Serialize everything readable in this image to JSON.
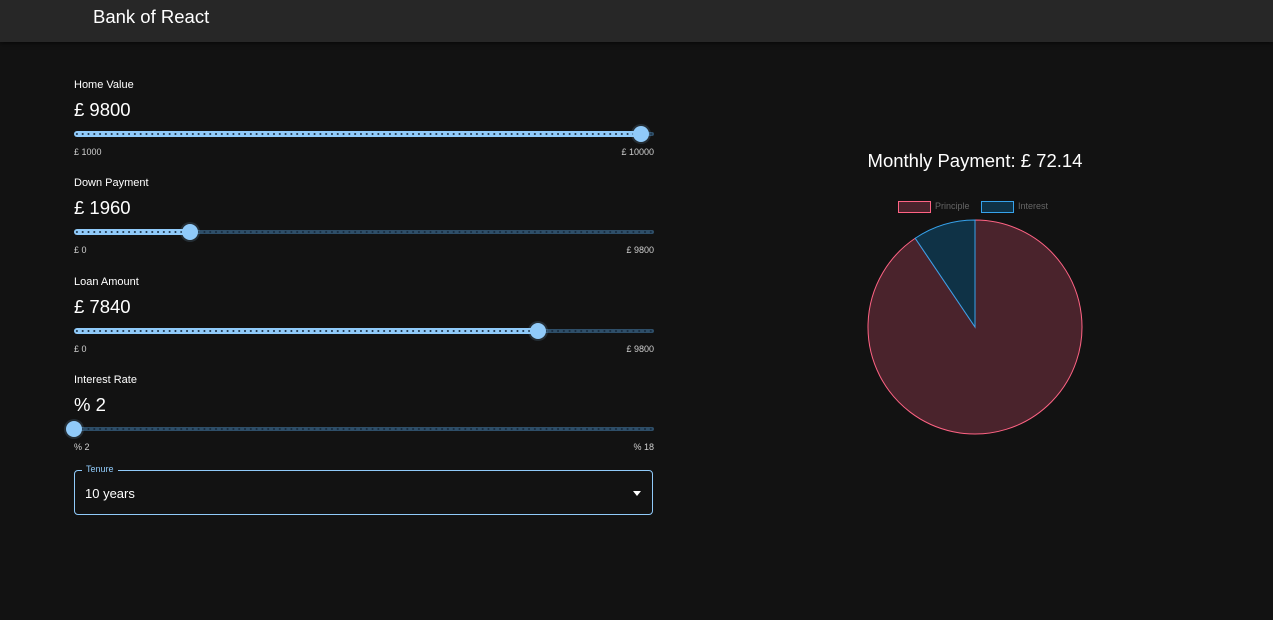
{
  "app": {
    "title": "Bank of React"
  },
  "sliders": [
    {
      "label": "Home Value",
      "value_text": "£ 9800",
      "value": 9800,
      "min": 1000,
      "max": 10000,
      "min_text": "£ 1000",
      "max_text": "£ 10000"
    },
    {
      "label": "Down Payment",
      "value_text": "£ 1960",
      "value": 1960,
      "min": 0,
      "max": 9800,
      "min_text": "£ 0",
      "max_text": "£ 9800"
    },
    {
      "label": "Loan Amount",
      "value_text": "£ 7840",
      "value": 7840,
      "min": 0,
      "max": 9800,
      "min_text": "£ 0",
      "max_text": "£ 9800"
    },
    {
      "label": "Interest Rate",
      "value_text": "% 2",
      "value": 2,
      "min": 2,
      "max": 18,
      "min_text": "% 2",
      "max_text": "% 18"
    }
  ],
  "tenure": {
    "label": "Tenure",
    "value": "10 years"
  },
  "payment": {
    "title": "Monthly Payment: £ 72.14"
  },
  "colors": {
    "accent": "#90caf9",
    "principle_fill": "#4a232c",
    "principle_border": "#ff6384",
    "interest_fill": "#0f3246",
    "interest_border": "#36a2eb"
  },
  "chart_data": {
    "type": "pie",
    "title": "Monthly Payment: £ 72.14",
    "legend_position": "top",
    "series": [
      {
        "name": "Principle",
        "value": 7840
      },
      {
        "name": "Interest",
        "value": 816.8
      }
    ]
  }
}
